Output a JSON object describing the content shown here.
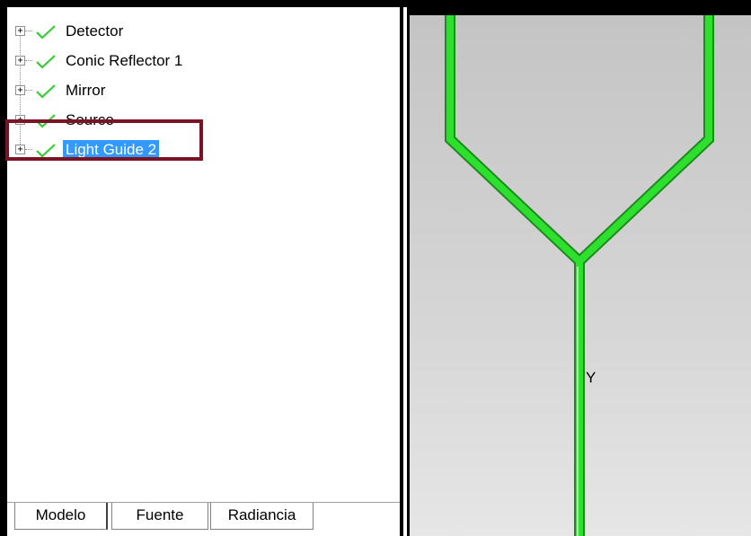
{
  "tree": {
    "items": [
      {
        "label": "Detector",
        "selected": false
      },
      {
        "label": "Conic Reflector 1",
        "selected": false
      },
      {
        "label": "Mirror",
        "selected": false
      },
      {
        "label": "Source",
        "selected": false
      },
      {
        "label": "Light Guide 2",
        "selected": true
      }
    ],
    "expander_symbol": "+",
    "check_icon": "checkmark-icon",
    "check_color": "#33cc33"
  },
  "tabs": [
    {
      "label": "Modelo",
      "active": true
    },
    {
      "label": "Fuente",
      "active": false
    },
    {
      "label": "Radiancia",
      "active": false
    }
  ],
  "viewport": {
    "axis_label": "Y",
    "model_color": "#2ee02e"
  },
  "colors": {
    "selection": "#3399ff",
    "highlight_border": "#7a1424"
  }
}
